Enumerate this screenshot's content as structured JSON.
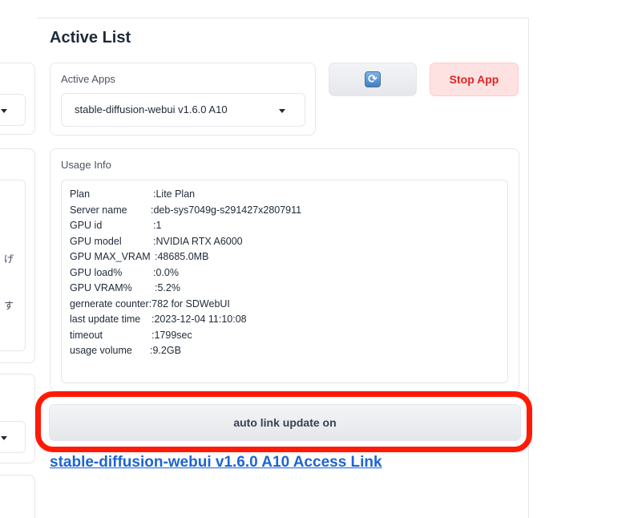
{
  "section": {
    "title": "Active List"
  },
  "active_apps": {
    "label": "Active Apps",
    "selected": "stable-diffusion-webui v1.6.0 A10"
  },
  "buttons": {
    "refresh_icon": "refresh-icon",
    "stop_label": "Stop App",
    "auto_link_label": "auto link update on"
  },
  "usage_info": {
    "label": "Usage Info",
    "rows": [
      {
        "key": "Plan",
        "value": ":Lite Plan"
      },
      {
        "key": "Server name",
        "value": ":deb-sys7049g-s291427x2807911"
      },
      {
        "key": "GPU id",
        "value": ":1"
      },
      {
        "key": "GPU model",
        "value": ":NVIDIA RTX A6000"
      },
      {
        "key": "GPU MAX_VRAM",
        "value": ":48685.0MB"
      },
      {
        "key": "GPU load%",
        "value": ":0.0%"
      },
      {
        "key": "GPU VRAM%",
        "value": ":5.2%"
      },
      {
        "key": "gernerate counter",
        "value": ":782 for SDWebUI"
      },
      {
        "key": "last update time",
        "value": ":2023-12-04 11:10:08"
      },
      {
        "key": "timeout",
        "value": ":1799sec"
      },
      {
        "key": "usage volume",
        "value": ":9.2GB"
      }
    ]
  },
  "access_link": {
    "text": "stable-diffusion-webui v1.6.0 A10 Access Link"
  },
  "left_column": {
    "fragments": [
      "げ",
      "す"
    ]
  },
  "colors": {
    "highlight": "#ff1a05",
    "stop_text": "#dc2626",
    "link": "#1d64d6"
  }
}
